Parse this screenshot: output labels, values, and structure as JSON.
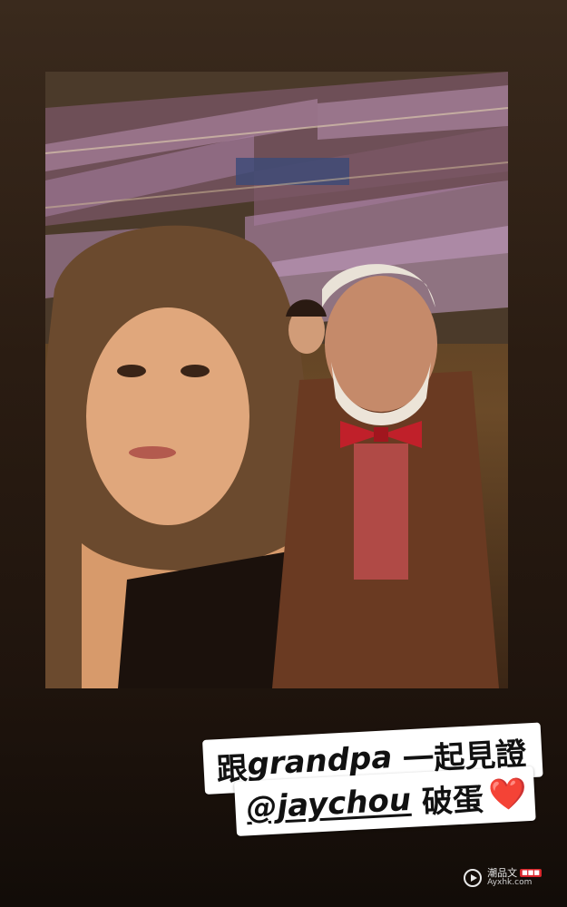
{
  "story": {
    "caption_line1_cjk_start": "跟",
    "caption_line1_latin": "grandpa",
    "caption_line1_cjk_end": "一起見證",
    "caption_line2_mention": "@jaychou",
    "caption_line2_cjk": "破蛋",
    "caption_line2_emoji": "❤️",
    "photo_alt": "Selfie at a concert arena with an elderly man in a bow tie"
  },
  "watermark": {
    "brand": "潮品文",
    "badge": "■■■",
    "domain": "Ayxhk.com"
  },
  "colors": {
    "background": "#2a1c12",
    "sticker": "#ffffff",
    "heart": "#e4303e"
  }
}
